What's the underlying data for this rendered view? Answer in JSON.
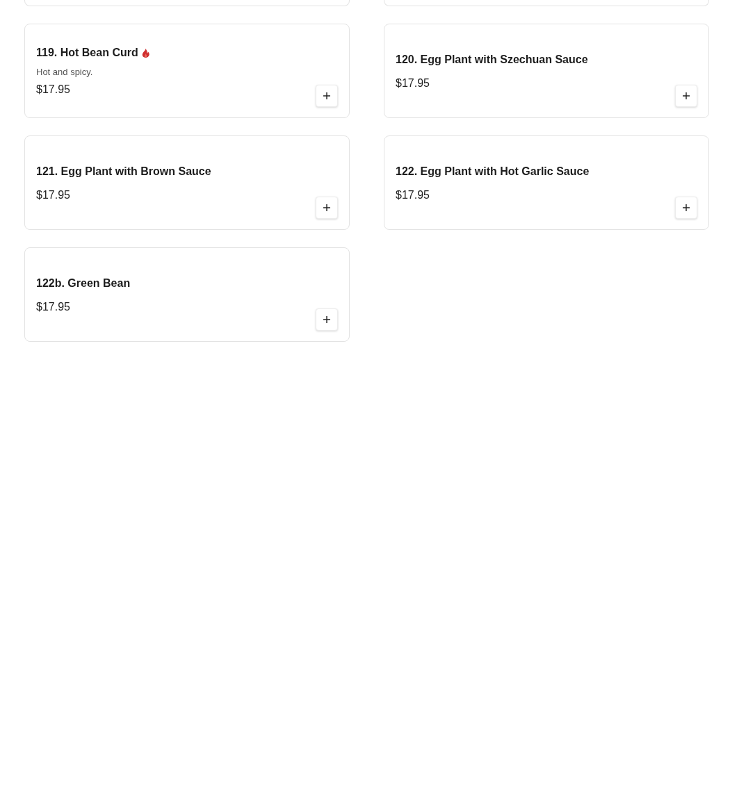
{
  "cut_off_cards": [
    {
      "kind": "bottom-edge"
    },
    {
      "kind": "bottom-edge"
    }
  ],
  "menu_items": [
    {
      "title": "119. Hot Bean Curd",
      "spicy": true,
      "description": "Hot and spicy.",
      "price": "$17.95"
    },
    {
      "title": "120. Egg Plant with Szechuan Sauce",
      "spicy": false,
      "price": "$17.95"
    },
    {
      "title": "121. Egg Plant with Brown Sauce",
      "spicy": false,
      "price": "$17.95"
    },
    {
      "title": "122. Egg Plant with Hot Garlic Sauce",
      "spicy": false,
      "price": "$17.95"
    },
    {
      "title": "122b. Green Bean",
      "spicy": false,
      "price": "$17.95"
    }
  ]
}
